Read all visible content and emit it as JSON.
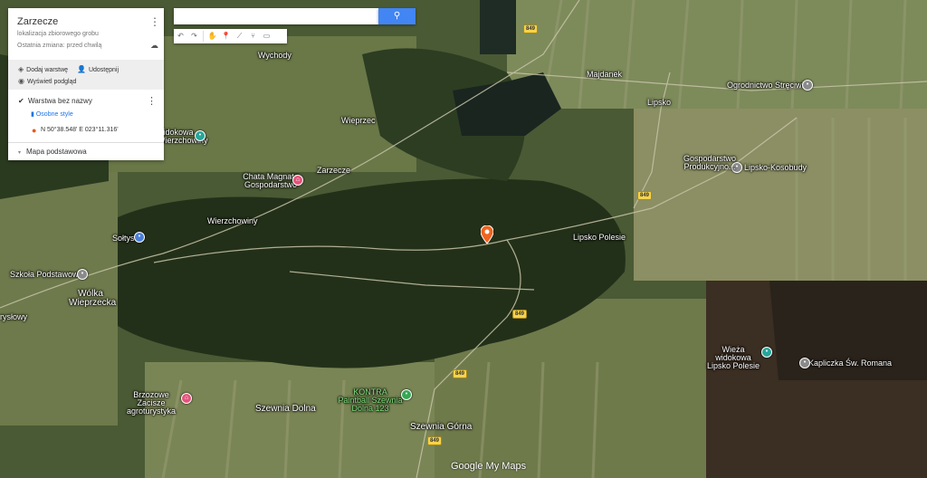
{
  "panel": {
    "title": "Zarzecze",
    "subtitle": "lokalizacja zbiorowego grobu",
    "last_change": "Ostatnia zmiana: przed chwilą",
    "add_layer": "Dodaj warstwę",
    "share": "Udostępnij",
    "preview": "Wyświetl podgląd",
    "layer_name": "Warstwa bez nazwy",
    "individual_styles": "Osobne style",
    "coordinates": "N 50°38.548' E 023°11.316'",
    "basemap": "Mapa podstawowa"
  },
  "search": {
    "placeholder": "",
    "button_icon": "search-icon"
  },
  "toolbar": [
    "undo-icon",
    "redo-icon",
    "hand-icon",
    "marker-icon",
    "line-icon",
    "route-icon",
    "ruler-icon"
  ],
  "places": [
    {
      "name": "Wychody"
    },
    {
      "name": "Majdanek"
    },
    {
      "name": "Lipsko"
    },
    {
      "name": "Ogrodnictwo Stręciwilk"
    },
    {
      "name": "Wieprzec"
    },
    {
      "name": "Zarzecze"
    },
    {
      "name": "Chata Magnata Gospodarstwo"
    },
    {
      "name": "Wierzchowiny"
    },
    {
      "name": "Sołtys"
    },
    {
      "name": "Szkoła Podstawowa"
    },
    {
      "name": "Wólka Wieprzecka"
    },
    {
      "name": "Lipsko-Kosobudy"
    },
    {
      "name": "Gospodarstwo Produkcyjno..."
    },
    {
      "name": "Lipsko Polesie"
    },
    {
      "name": "Wieża widokowa Lipsko Polesie"
    },
    {
      "name": "Kapliczka Św. Romana"
    },
    {
      "name": "Brzozowe Zacisze agroturystyka"
    },
    {
      "name": "Szewnia Dolna"
    },
    {
      "name": "KONTRA Paintball Szewnia Dolna 123"
    },
    {
      "name": "Szewnia Górna"
    },
    {
      "name": "widokowa Wierzchowiny"
    },
    {
      "name": "rysłowy"
    }
  ],
  "roads": [
    "849",
    "849",
    "849",
    "849",
    "849"
  ],
  "brand": "Google My Maps"
}
